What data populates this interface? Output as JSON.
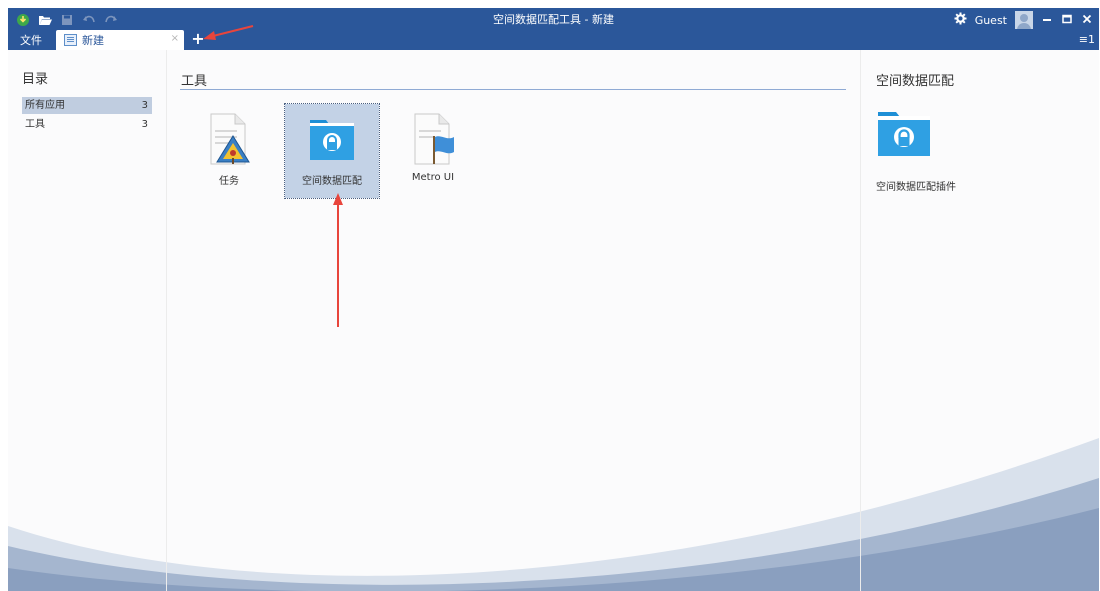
{
  "window": {
    "title": "空间数据匹配工具 - 新建",
    "user": "Guest",
    "list_count": "≡1",
    "quick_access_icons": [
      "logo-icon",
      "open-folder-icon",
      "save-icon",
      "undo-icon",
      "redo-icon"
    ]
  },
  "menu": {
    "file_label": "文件"
  },
  "tabs": [
    {
      "label": "新建",
      "close": "×"
    }
  ],
  "add_tab": "+",
  "sidebar": {
    "title": "目录",
    "items": [
      {
        "label": "所有应用",
        "count": "3",
        "selected": true
      },
      {
        "label": "工具",
        "count": "3",
        "selected": false
      }
    ]
  },
  "main": {
    "title": "工具",
    "apps": [
      {
        "label": "任务",
        "icon": "task-icon"
      },
      {
        "label": "空间数据匹配",
        "icon": "locked-folder-icon",
        "selected": true
      },
      {
        "label": "Metro UI",
        "icon": "flag-document-icon"
      }
    ]
  },
  "detail": {
    "title": "空间数据匹配",
    "icon": "locked-folder-icon",
    "description": "空间数据匹配插件"
  },
  "colors": {
    "titlebar": "#2b579a",
    "selection": "#c3d2e6",
    "folder_blue": "#1e8fd6",
    "annotation_red": "#e8453c"
  }
}
